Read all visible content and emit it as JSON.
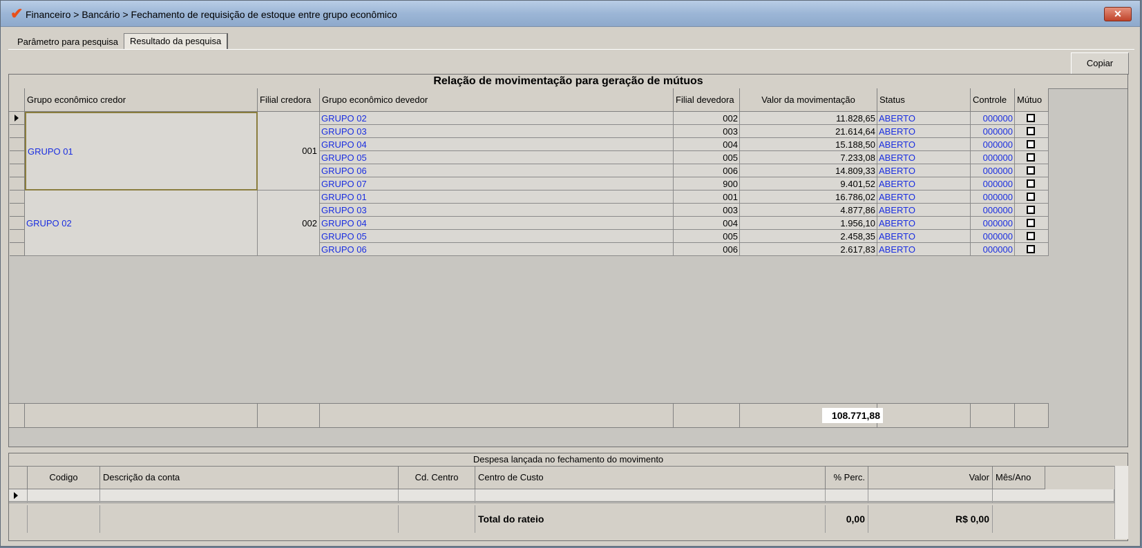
{
  "window": {
    "title": "Financeiro > Bancário > Fechamento de requisição de estoque entre grupo econômico",
    "close_label": "✕"
  },
  "tabs": [
    {
      "label": "Parâmetro para pesquisa",
      "active": false
    },
    {
      "label": "Resultado da pesquisa",
      "active": true
    }
  ],
  "toolbar": {
    "copy_label": "Copiar"
  },
  "grid1": {
    "title": "Relação de movimentação para geração de mútuos",
    "columns": [
      "Grupo econômico credor",
      "Filial credora",
      "Grupo econômico devedor",
      "Filial devedora",
      "Valor da movimentação",
      "Status",
      "Controle",
      "Mútuo"
    ],
    "groups": [
      {
        "credor": "GRUPO 01",
        "filial_credora": "001",
        "rows": [
          {
            "devedor": "GRUPO 02",
            "filial": "002",
            "valor": "11.828,65",
            "status": "ABERTO",
            "controle": "000000"
          },
          {
            "devedor": "GRUPO 03",
            "filial": "003",
            "valor": "21.614,64",
            "status": "ABERTO",
            "controle": "000000"
          },
          {
            "devedor": "GRUPO 04",
            "filial": "004",
            "valor": "15.188,50",
            "status": "ABERTO",
            "controle": "000000"
          },
          {
            "devedor": "GRUPO 05",
            "filial": "005",
            "valor": "7.233,08",
            "status": "ABERTO",
            "controle": "000000"
          },
          {
            "devedor": "GRUPO 06",
            "filial": "006",
            "valor": "14.809,33",
            "status": "ABERTO",
            "controle": "000000"
          },
          {
            "devedor": "GRUPO 07",
            "filial": "900",
            "valor": "9.401,52",
            "status": "ABERTO",
            "controle": "000000"
          }
        ]
      },
      {
        "credor": "GRUPO 02",
        "filial_credora": "002",
        "rows": [
          {
            "devedor": "GRUPO 01",
            "filial": "001",
            "valor": "16.786,02",
            "status": "ABERTO",
            "controle": "000000"
          },
          {
            "devedor": "GRUPO 03",
            "filial": "003",
            "valor": "4.877,86",
            "status": "ABERTO",
            "controle": "000000"
          },
          {
            "devedor": "GRUPO 04",
            "filial": "004",
            "valor": "1.956,10",
            "status": "ABERTO",
            "controle": "000000"
          },
          {
            "devedor": "GRUPO 05",
            "filial": "005",
            "valor": "2.458,35",
            "status": "ABERTO",
            "controle": "000000"
          },
          {
            "devedor": "GRUPO 06",
            "filial": "006",
            "valor": "2.617,83",
            "status": "ABERTO",
            "controle": "000000"
          }
        ]
      }
    ],
    "total": "108.771,88"
  },
  "grid2": {
    "title": "Despesa lançada no fechamento do movimento",
    "columns": [
      "Codigo",
      "Descrição da conta",
      "Cd. Centro",
      "Centro de Custo",
      "% Perc.",
      "Valor",
      "Mês/Ano"
    ],
    "total_label": "Total do rateio",
    "total_perc": "0,00",
    "total_valor": "R$ 0,00"
  }
}
